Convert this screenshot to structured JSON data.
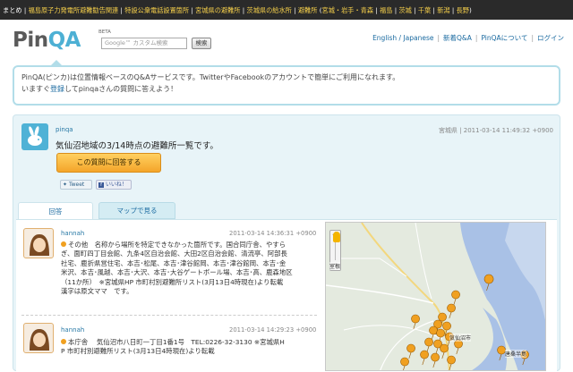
{
  "topbar": {
    "lead": "まとめ",
    "links": [
      "福島原子力発電所避難勧告関連",
      "特設公衆電話設置箇所",
      "宮城県の避難所",
      "茨城県の給水所",
      "避難所"
    ],
    "regions_open": "(",
    "regions": [
      "宮城・岩手・青森",
      "福島",
      "茨城",
      "千葉",
      "新潟",
      "長野"
    ],
    "regions_close": ")"
  },
  "header": {
    "logo_pin": "Pin",
    "logo_qa": "QA",
    "beta": "BETA",
    "search_placeholder": "Google™ カスタム検索",
    "search_button": "検索",
    "nav": [
      "English / Japanese",
      "新着Q&A",
      "PinQAについて",
      "ログイン"
    ]
  },
  "intro": {
    "line1": "PinQA(ピンカ)は位置情報ベースのQ&Aサービスです。TwitterやFacebookのアカウントで簡単にご利用になれます。",
    "line2_prefix": "いますぐ",
    "register_link": "登録",
    "line2_suffix": "してpinqaさんの質問に答えよう！"
  },
  "question": {
    "user": "pinqa",
    "location": "宮城県",
    "timestamp": "2011-03-14 11:49:32 +0900",
    "title": "気仙沼地域の3/14時点の避難所一覧です。",
    "answer_button": "この質問に回答する",
    "tweet": "Tweet",
    "like": "いいね！"
  },
  "tabs": [
    "回答",
    "マップで見る"
  ],
  "answers": [
    {
      "user": "hannah",
      "timestamp": "2011-03-14 14:36:31 +0900",
      "lines": [
        "その他　名称から場所を特定できなかった箇所です。国合同庁舎、やすら",
        "ぎ、面町四丁目会館、九条4区自治会館、大田2区自治会館、清流亭、阿部長",
        "社宅、鹿折県営住宅、本吉･松尾、本吉･津谷館岡、本吉･津谷館岡、本吉･金",
        "米沢、本吉･風越、本吉･大沢、本吉･大谷ゲートボール場、本吉･高、鹿森地区",
        "（11か所）　※宮城県HP 市町村別避難所リスト(3月13日4時現在)より転載",
        "漢字は原文ママ　です。"
      ]
    },
    {
      "user": "hannah",
      "timestamp": "2011-03-14 14:29:23 +0900",
      "lines": [
        "本庁舎　 気仙沼市八日町一丁目1番1号　TEL:0226-32-3130 ※宮城県H",
        "P 市町村別避難所リスト(3月13日4時現在)より転載"
      ]
    }
  ],
  "map": {
    "labels": [
      "室根",
      "気仙沼市",
      "唐桑半島"
    ]
  }
}
